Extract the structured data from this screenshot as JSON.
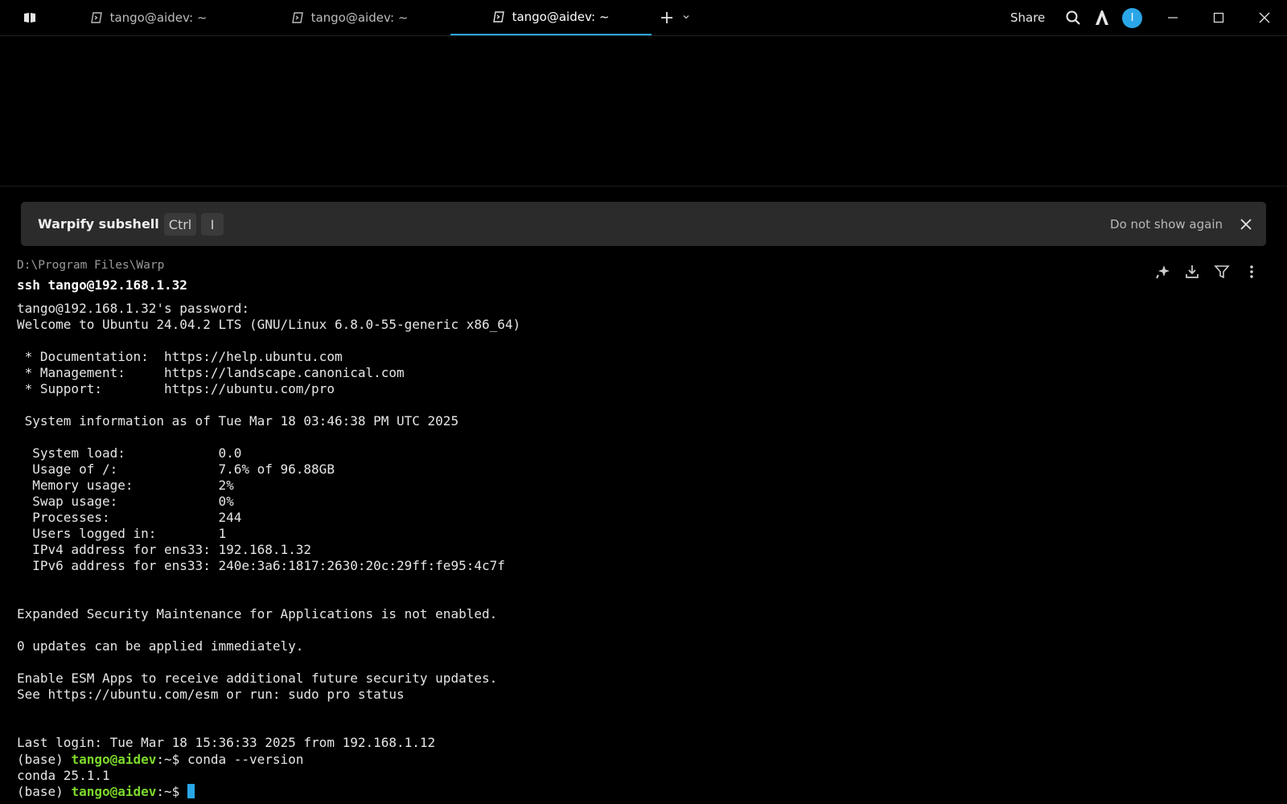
{
  "tabs": [
    {
      "label": "tango@aidev: ~"
    },
    {
      "label": "tango@aidev: ~"
    },
    {
      "label": "tango@aidev: ~"
    }
  ],
  "header": {
    "share_label": "Share",
    "avatar_letter": "I"
  },
  "banner": {
    "title": "Warpify subshell",
    "key1": "Ctrl",
    "key2": "I",
    "dismiss_label": "Do not show again"
  },
  "block": {
    "cwd": "D:\\Program Files\\Warp",
    "command": "ssh tango@192.168.1.32",
    "output": "tango@192.168.1.32's password:\nWelcome to Ubuntu 24.04.2 LTS (GNU/Linux 6.8.0-55-generic x86_64)\n\n * Documentation:  https://help.ubuntu.com\n * Management:     https://landscape.canonical.com\n * Support:        https://ubuntu.com/pro\n\n System information as of Tue Mar 18 03:46:38 PM UTC 2025\n\n  System load:            0.0\n  Usage of /:             7.6% of 96.88GB\n  Memory usage:           2%\n  Swap usage:             0%\n  Processes:              244\n  Users logged in:        1\n  IPv4 address for ens33: 192.168.1.32\n  IPv6 address for ens33: 240e:3a6:1817:2630:20c:29ff:fe95:4c7f\n\n\nExpanded Security Maintenance for Applications is not enabled.\n\n0 updates can be applied immediately.\n\nEnable ESM Apps to receive additional future security updates.\nSee https://ubuntu.com/esm or run: sudo pro status\n\n\nLast login: Tue Mar 18 15:36:33 2025 from 192.168.1.12",
    "prompt1_env": "(base) ",
    "prompt1_user": "tango@aidev",
    "prompt1_rest": ":~$ ",
    "prompt1_cmd": "conda --version",
    "conda_output": "conda 25.1.1",
    "prompt2_env": "(base) ",
    "prompt2_user": "tango@aidev",
    "prompt2_rest": ":~$ "
  },
  "colors": {
    "accent": "#2aa6e8",
    "user_green": "#7bd82c",
    "background": "#000000",
    "banner_bg": "#2b2b2b"
  },
  "icons": [
    "menu-icon",
    "terminal-icon",
    "plus-icon",
    "chevron-down-icon",
    "search-icon",
    "warp-logo-icon",
    "minimize-icon",
    "maximize-icon",
    "close-icon",
    "sparkle-icon",
    "download-icon",
    "filter-icon",
    "more-vertical-icon"
  ]
}
